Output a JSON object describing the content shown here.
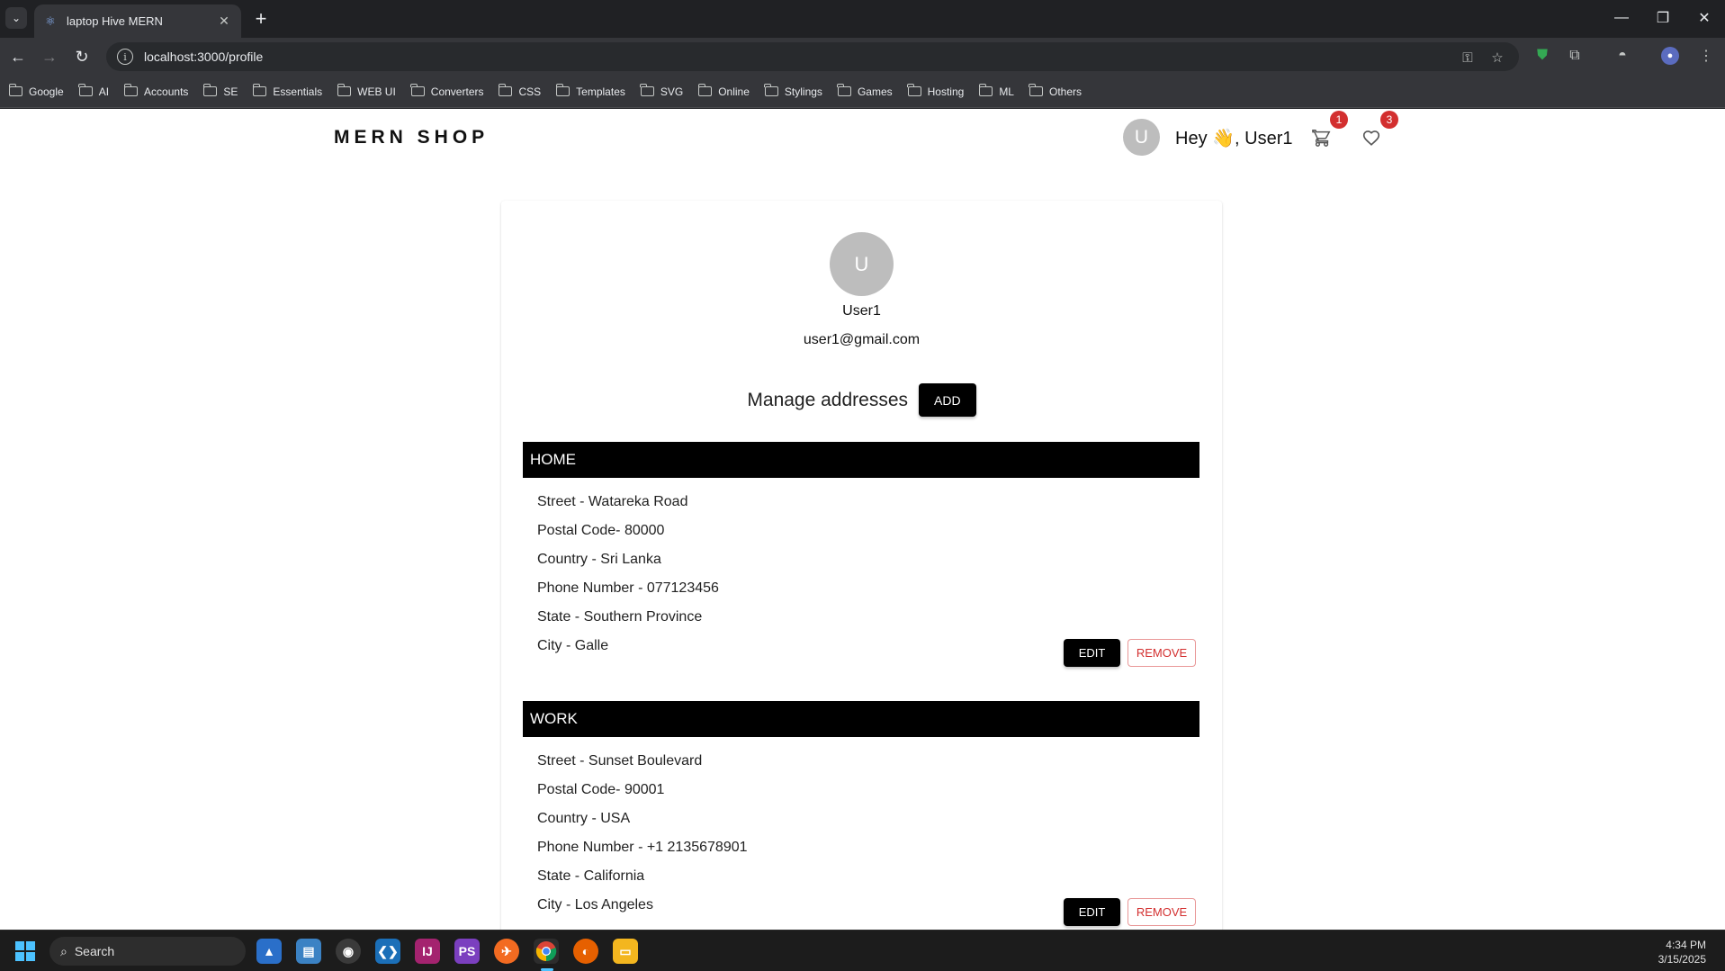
{
  "browser": {
    "tab_title": "laptop Hive MERN",
    "url": "localhost:3000/profile",
    "bookmarks": [
      "Google",
      "AI",
      "Accounts",
      "SE",
      "Essentials",
      "WEB UI",
      "Converters",
      "CSS",
      "Templates",
      "SVG",
      "Online",
      "Stylings",
      "Games",
      "Hosting",
      "ML",
      "Others"
    ]
  },
  "header": {
    "logo": "MERN SHOP",
    "avatar_letter": "U",
    "greeting": "Hey 👋, User1",
    "cart_count": "1",
    "wishlist_count": "3"
  },
  "profile": {
    "avatar_letter": "U",
    "name": "User1",
    "email": "user1@gmail.com",
    "manage_title": "Manage addresses",
    "add_label": "ADD"
  },
  "addresses": [
    {
      "type": "HOME",
      "street": "Street - Watareka Road",
      "postal": "Postal Code- 80000",
      "country": "Country - Sri Lanka",
      "phone": "Phone Number - 077123456",
      "state": "State - Southern Province",
      "city": "City - Galle",
      "edit_label": "EDIT",
      "remove_label": "REMOVE"
    },
    {
      "type": "WORK",
      "street": "Street - Sunset Boulevard",
      "postal": "Postal Code- 90001",
      "country": "Country - USA",
      "phone": "Phone Number - +1 2135678901",
      "state": "State - California",
      "city": "City - Los Angeles",
      "edit_label": "EDIT",
      "remove_label": "REMOVE"
    }
  ],
  "taskbar": {
    "search_placeholder": "Search",
    "time": "4:34 PM",
    "date": "3/15/2025"
  },
  "colors": {
    "accent": "#000000",
    "badge": "#d32f2f",
    "remove": "#d32f2f"
  }
}
